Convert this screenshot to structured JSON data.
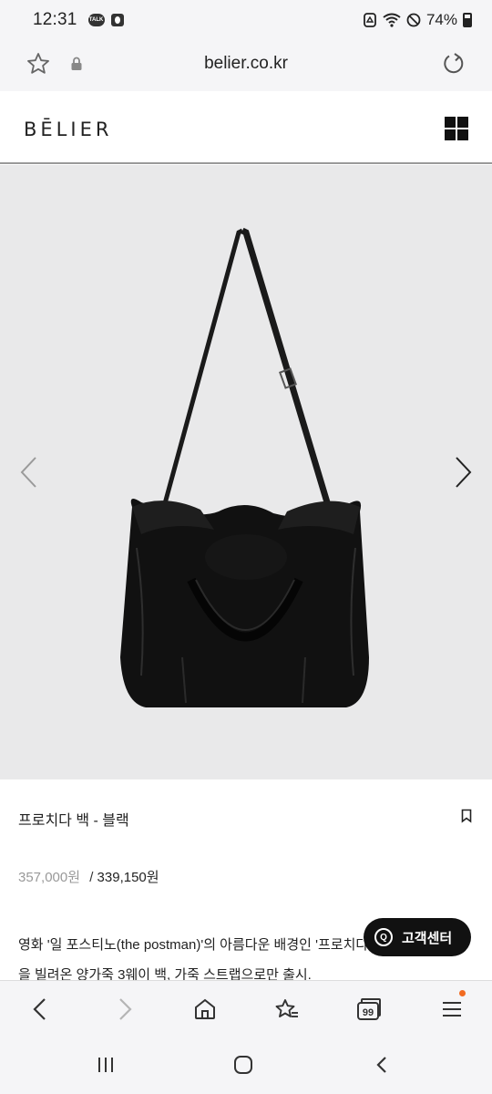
{
  "status_bar": {
    "time": "12:31",
    "talk_badge": "TALK",
    "battery": "74%"
  },
  "browser": {
    "url": "belier.co.kr",
    "tabs_count": "99"
  },
  "site": {
    "logo": "BĒLIER"
  },
  "product": {
    "title": "프로치다 백 - 블랙",
    "original_price": "357,000원",
    "price_separator": "/",
    "sale_price": "339,150원",
    "description_line1": "영화 '일 포스티노(the postman)'의 아름다운 배경인 '프로치다' 섬의 이름",
    "description_line2": "을 빌려온 양가죽 3웨이 백, 가죽 스트랩으로만 출시."
  },
  "customer_service": {
    "label": "고객센터",
    "icon_letter": "Q"
  },
  "colors": {
    "accent_orange": "#f26b21",
    "stage_background": "#e9e9ea",
    "cs_button": "#111111"
  }
}
